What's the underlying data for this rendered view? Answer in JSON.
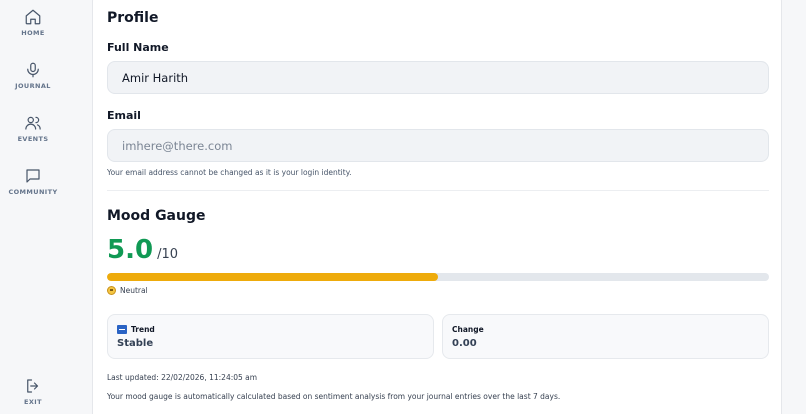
{
  "sidebar": {
    "items": [
      {
        "label": "HOME",
        "icon": "home-icon"
      },
      {
        "label": "JOURNAL",
        "icon": "microphone-icon"
      },
      {
        "label": "EVENTS",
        "icon": "users-icon"
      },
      {
        "label": "COMMUNITY",
        "icon": "chat-icon"
      }
    ],
    "exit": {
      "label": "EXIT",
      "icon": "exit-icon"
    }
  },
  "profile": {
    "title": "Profile",
    "full_name_label": "Full Name",
    "full_name_value": "Amir Harith",
    "email_label": "Email",
    "email_value": "imhere@there.com",
    "email_hint": "Your email address cannot be changed as it is your login identity."
  },
  "mood": {
    "title": "Mood Gauge",
    "score": "5.0",
    "max": "/10",
    "progress_fraction": 0.5,
    "status": "Neutral",
    "trend_label": "Trend",
    "trend_value": "Stable",
    "change_label": "Change",
    "change_value": "0.00",
    "last_updated": "Last updated: 22/02/2026, 11:24:05 am",
    "description": "Your mood gauge is automatically calculated based on sentiment analysis from your journal entries over the last 7 days."
  },
  "colors": {
    "score_green": "#109954",
    "progress_fill": "#eeab0b",
    "progress_track": "#e3e7ec"
  }
}
